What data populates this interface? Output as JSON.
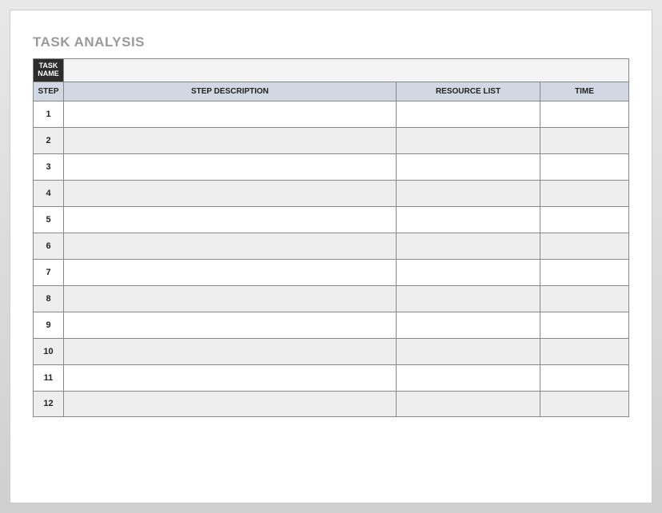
{
  "title": "TASK ANALYSIS",
  "task_name_header": "TASK\nNAME",
  "task_name_value": "",
  "columns": {
    "step": "STEP",
    "description": "STEP DESCRIPTION",
    "resource": "RESOURCE LIST",
    "time": "TIME"
  },
  "rows": [
    {
      "step": "1",
      "description": "",
      "resource": "",
      "time": ""
    },
    {
      "step": "2",
      "description": "",
      "resource": "",
      "time": ""
    },
    {
      "step": "3",
      "description": "",
      "resource": "",
      "time": ""
    },
    {
      "step": "4",
      "description": "",
      "resource": "",
      "time": ""
    },
    {
      "step": "5",
      "description": "",
      "resource": "",
      "time": ""
    },
    {
      "step": "6",
      "description": "",
      "resource": "",
      "time": ""
    },
    {
      "step": "7",
      "description": "",
      "resource": "",
      "time": ""
    },
    {
      "step": "8",
      "description": "",
      "resource": "",
      "time": ""
    },
    {
      "step": "9",
      "description": "",
      "resource": "",
      "time": ""
    },
    {
      "step": "10",
      "description": "",
      "resource": "",
      "time": ""
    },
    {
      "step": "11",
      "description": "",
      "resource": "",
      "time": ""
    },
    {
      "step": "12",
      "description": "",
      "resource": "",
      "time": ""
    }
  ]
}
